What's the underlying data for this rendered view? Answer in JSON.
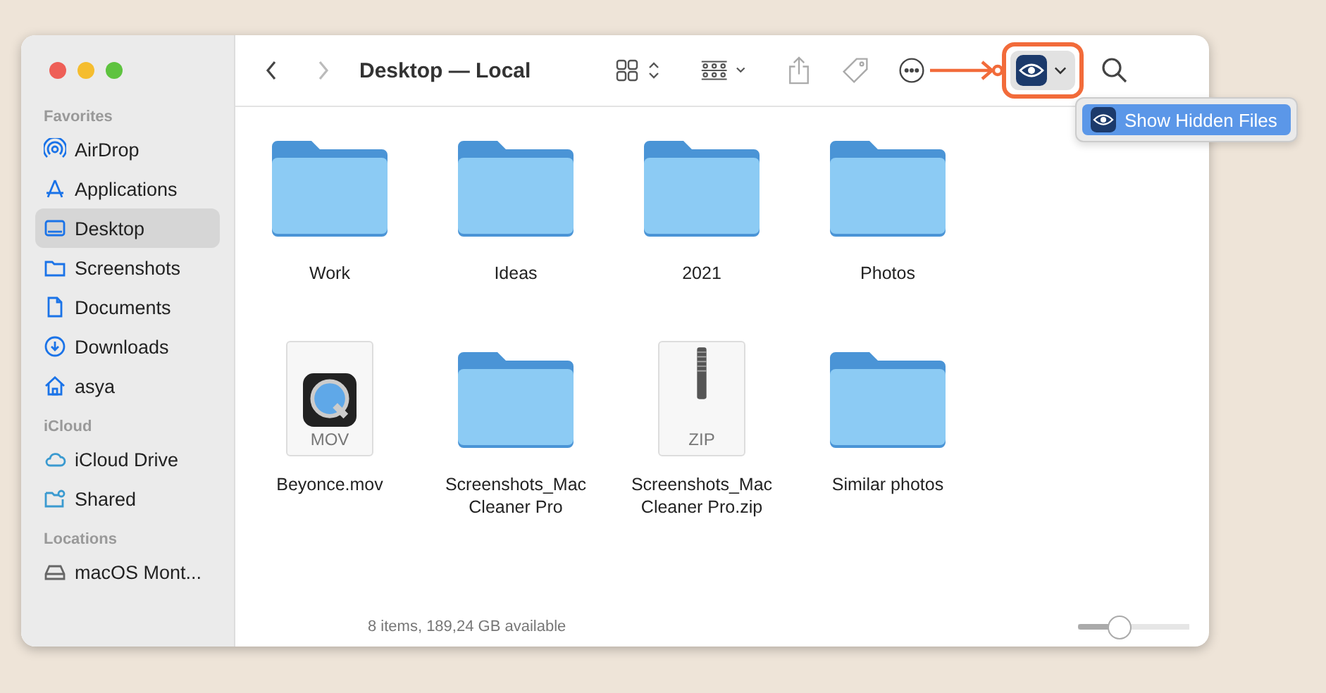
{
  "window": {
    "title": "Desktop — Local"
  },
  "sidebar": {
    "sections": [
      {
        "heading": "Favorites",
        "items": [
          {
            "label": "AirDrop",
            "kind": "airdrop",
            "selected": false
          },
          {
            "label": "Applications",
            "kind": "apps",
            "selected": false
          },
          {
            "label": "Desktop",
            "kind": "desktop",
            "selected": true
          },
          {
            "label": "Screenshots",
            "kind": "folder",
            "selected": false
          },
          {
            "label": "Documents",
            "kind": "doc",
            "selected": false
          },
          {
            "label": "Downloads",
            "kind": "download",
            "selected": false
          },
          {
            "label": "asya",
            "kind": "home",
            "selected": false
          }
        ]
      },
      {
        "heading": "iCloud",
        "items": [
          {
            "label": "iCloud Drive",
            "kind": "cloud",
            "selected": false
          },
          {
            "label": "Shared",
            "kind": "shared",
            "selected": false
          }
        ]
      },
      {
        "heading": "Locations",
        "items": [
          {
            "label": "macOS Mont...",
            "kind": "disk",
            "selected": false
          }
        ]
      }
    ]
  },
  "files": [
    {
      "name": "Work",
      "kind": "folder"
    },
    {
      "name": "Ideas",
      "kind": "folder"
    },
    {
      "name": "2021",
      "kind": "folder"
    },
    {
      "name": "Photos",
      "kind": "folder"
    },
    {
      "name": "Beyonce.mov",
      "kind": "movie",
      "badge": "MOV"
    },
    {
      "name": "Screenshots_Mac Cleaner Pro",
      "kind": "folder"
    },
    {
      "name": "Screenshots_Mac Cleaner Pro.zip",
      "kind": "zip",
      "badge": "ZIP"
    },
    {
      "name": "Similar photos",
      "kind": "folder"
    }
  ],
  "menu": {
    "items": [
      {
        "label": "Show Hidden Files",
        "selected": true
      }
    ]
  },
  "status_bar": {
    "text": "8 items, 189,24 GB available"
  },
  "zoom_slider": {
    "level": 0.37
  }
}
